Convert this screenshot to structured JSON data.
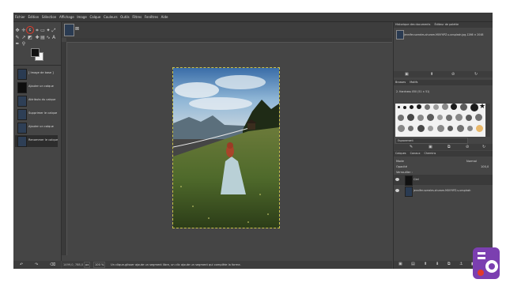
{
  "menubar": [
    "Fichier",
    "Édition",
    "Sélection",
    "Affichage",
    "Image",
    "Calque",
    "Couleurs",
    "Outils",
    "Filtres",
    "Fenêtres",
    "Aide"
  ],
  "history": {
    "items": [
      {
        "label": "[ Image de base ]"
      },
      {
        "label": "Ajouter un calque"
      },
      {
        "label": "Attributs du calque"
      },
      {
        "label": "Supprimer le calque"
      },
      {
        "label": "Ajouter un calque"
      },
      {
        "label": "Renommer le calque"
      }
    ]
  },
  "canvas": {
    "status_unit": "px",
    "zoom": "100 %",
    "status_message": "Un clique-glisser ajoute un segment libre, un clic ajoute un segment qui complète la forme."
  },
  "right_dock": {
    "tabs_top": [
      "Historique des documents",
      "Éditeur de palette"
    ],
    "document_name": "jennifer-sorrales-shuram-MXVYIPZ-s-unsplash.jpg-1266 × 2048",
    "tabs_brushes": [
      "Brosses",
      "Motifs"
    ],
    "brush_name": "2. Hardness 050 (51 × 51)",
    "brush_spacing_label": "Espacement",
    "tabs_layers": [
      "Calques",
      "Canaux",
      "Chemins"
    ],
    "mode_label": "Mode",
    "mode_value": "Normal",
    "opacity_label": "Opacité",
    "opacity_value": "100,0",
    "lock_label": "Verrouiller :",
    "layers": [
      {
        "name": "Ciel"
      },
      {
        "name": "jennifer-sorrales-shuram-MXVYIPZ-s-unsplash"
      }
    ]
  },
  "colors": {
    "accent_selection": "#c9c24a",
    "logo_purple": "#7b3fb0"
  }
}
